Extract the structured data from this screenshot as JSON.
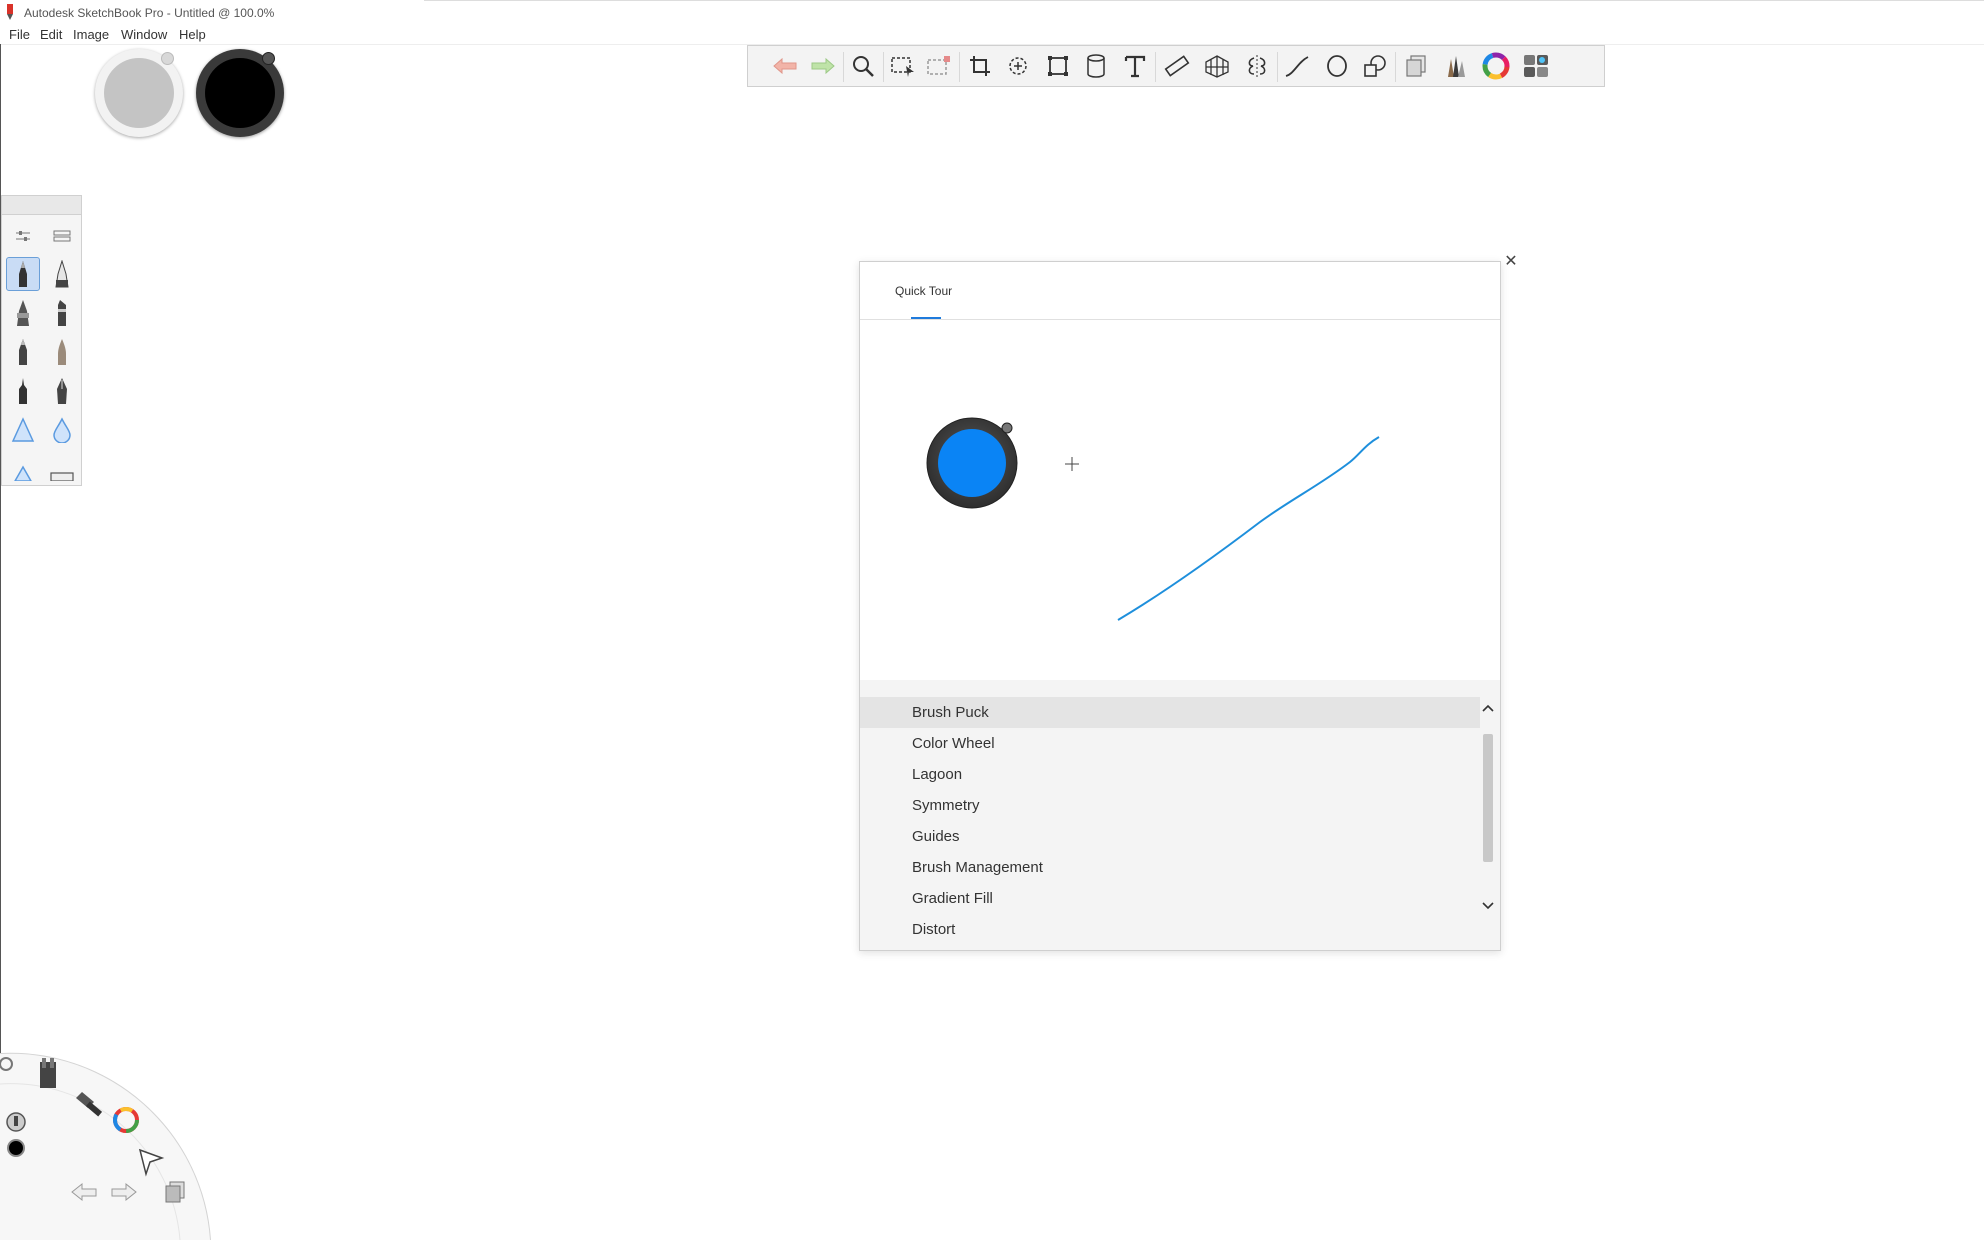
{
  "window": {
    "title": "Autodesk SketchBook Pro - Untitled @ 100.0%"
  },
  "menu": {
    "items": [
      "File",
      "Edit",
      "Image",
      "Window",
      "Help"
    ]
  },
  "colors": {
    "accent": "#1f7bdc",
    "puck_primary": "#c4c4c4",
    "puck_secondary": "#000000",
    "tour_puck": "#0a84f5"
  },
  "toolbar": {
    "tools": [
      "undo-icon",
      "redo-icon",
      "zoom-icon",
      "select-icon",
      "lasso-select-icon",
      "crop-icon",
      "quick-selection-icon",
      "transform-icon",
      "distort-icon",
      "text-icon",
      "ruler-icon",
      "perspective-icon",
      "symmetry-icon",
      "curve-icon",
      "ellipse-icon",
      "shape-icon",
      "layers-icon",
      "brush-library-icon",
      "color-wheel-icon",
      "copic-library-icon"
    ]
  },
  "dialog": {
    "tab_label": "Quick Tour",
    "items": [
      "Brush Puck",
      "Color Wheel",
      "Lagoon",
      "Symmetry",
      "Guides",
      "Brush Management",
      "Gradient Fill",
      "Distort"
    ],
    "selected_item": "Brush Puck"
  }
}
